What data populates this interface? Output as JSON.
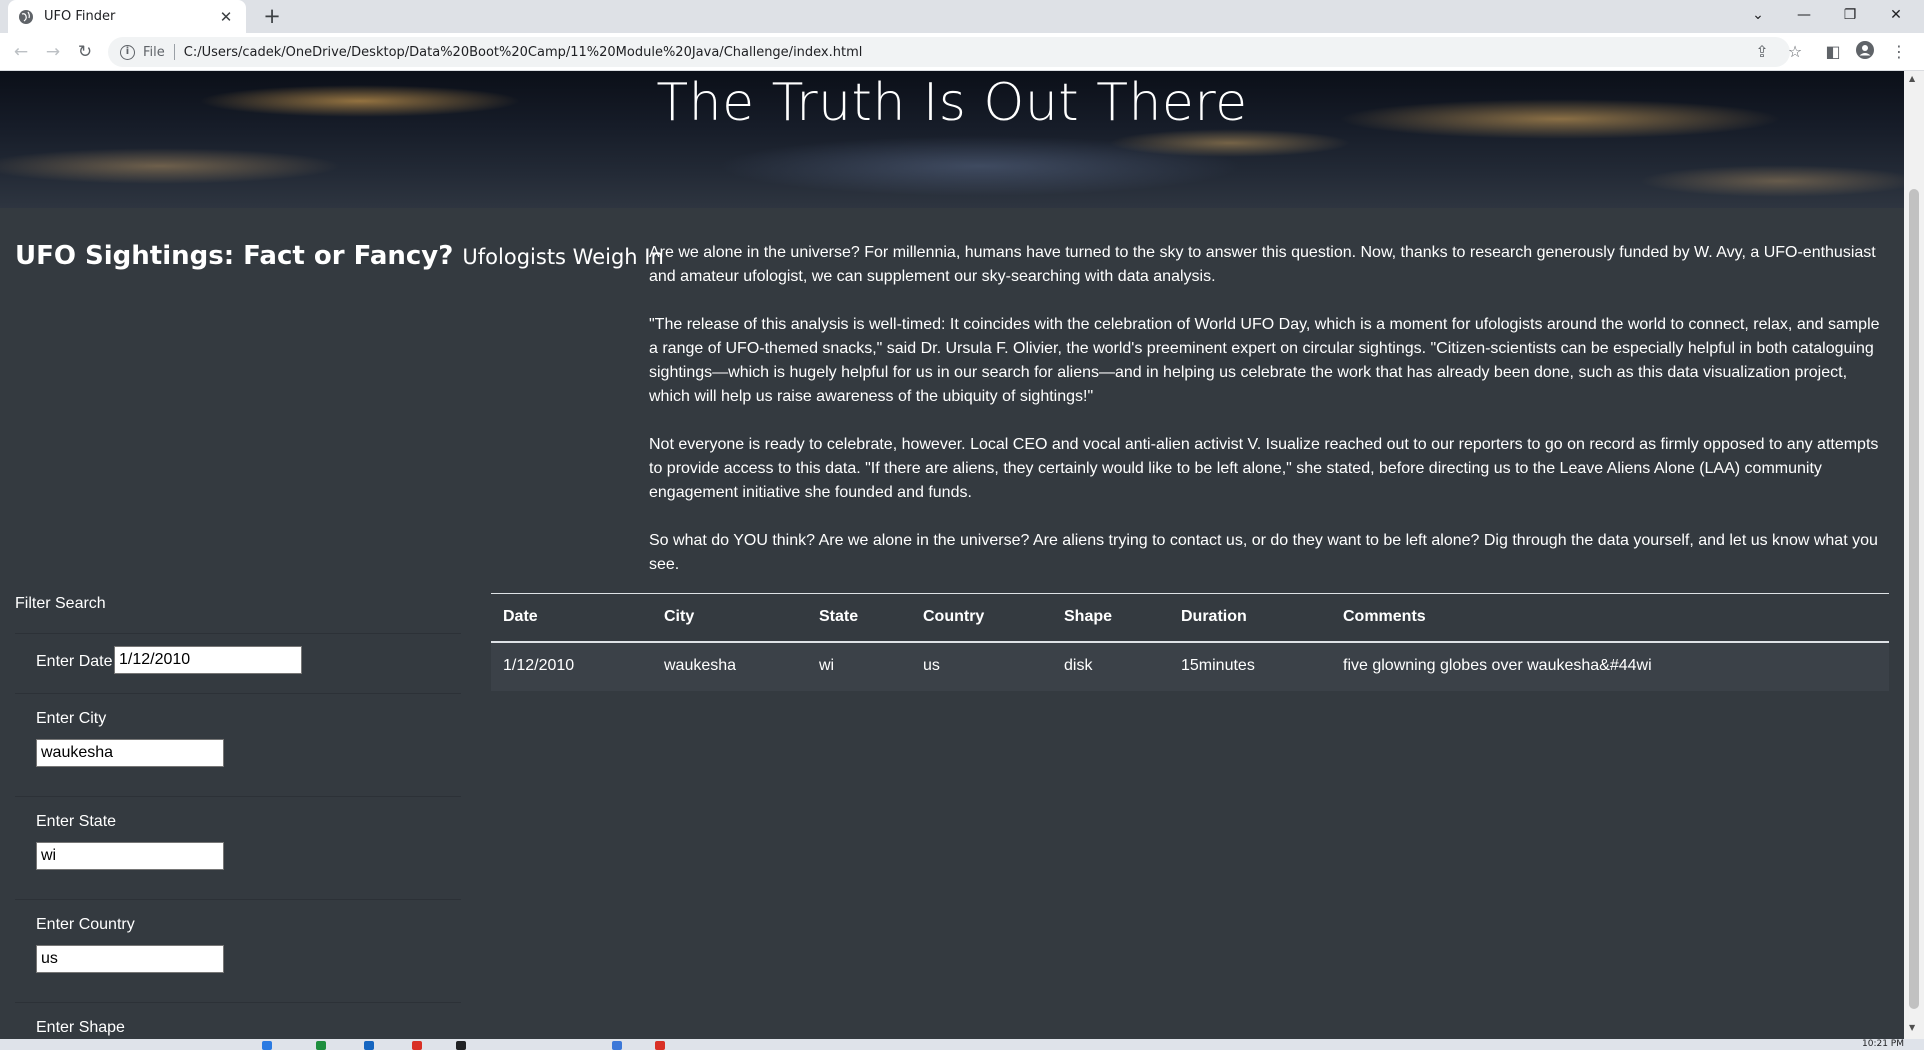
{
  "browser": {
    "tab_title": "UFO Finder",
    "tab_close": "✕",
    "new_tab": "+",
    "scheme": "File",
    "url": "C:/Users/cadek/OneDrive/Desktop/Data%20Boot%20Camp/11%20Module%20Java/Challenge/index.html"
  },
  "hero": {
    "title": "The Truth Is Out There"
  },
  "headline": {
    "main": "UFO Sightings: Fact or Fancy?",
    "sub": "Ufologists Weigh In"
  },
  "article": {
    "paragraphs": [
      "Are we alone in the universe? For millennia, humans have turned to the sky to answer this question. Now, thanks to research generously funded by W. Avy, a UFO-enthusiast and amateur ufologist, we can supplement our sky-searching with data analysis.",
      "\"The release of this analysis is well-timed: It coincides with the celebration of World UFO Day, which is a moment for ufologists around the world to connect, relax, and sample a range of UFO-themed snacks,\" said Dr. Ursula F. Olivier, the world's preeminent expert on circular sightings. \"Citizen-scientists can be especially helpful in both cataloguing sightings—which is hugely helpful for us in our search for aliens—and in helping us celebrate the work that has already been done, such as this data visualization project, which will help us raise awareness of the ubiquity of sightings!\"",
      "Not everyone is ready to celebrate, however. Local CEO and vocal anti-alien activist V. Isualize reached out to our reporters to go on record as firmly opposed to any attempts to provide access to this data. \"If there are aliens, they certainly would like to be left alone,\" she stated, before directing us to the Leave Aliens Alone (LAA) community engagement initiative she founded and funds.",
      "So what do YOU think? Are we alone in the universe? Are aliens trying to contact us, or do they want to be left alone? Dig through the data yourself, and let us know what you see."
    ]
  },
  "filter": {
    "title": "Filter Search",
    "date": {
      "label": "Enter Date",
      "value": "1/12/2010"
    },
    "city": {
      "label": "Enter City",
      "value": "waukesha"
    },
    "state": {
      "label": "Enter State",
      "value": "wi"
    },
    "country": {
      "label": "Enter Country",
      "value": "us"
    },
    "shape": {
      "label": "Enter Shape"
    }
  },
  "table": {
    "headers": [
      "Date",
      "City",
      "State",
      "Country",
      "Shape",
      "Duration",
      "Comments"
    ],
    "rows": [
      [
        "1/12/2010",
        "waukesha",
        "wi",
        "us",
        "disk",
        "15minutes",
        "five glowning globes over waukesha&#44wi"
      ]
    ]
  },
  "taskbar": {
    "time": "10:21 PM"
  }
}
